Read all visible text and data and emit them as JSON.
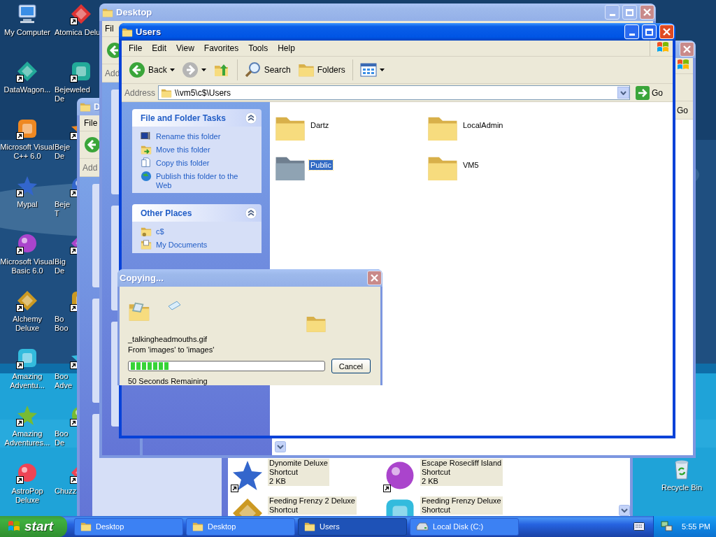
{
  "desktop_icons": [
    {
      "lines": [
        "My Computer"
      ],
      "shortcut": false
    },
    {
      "lines": [
        "DataWagon..."
      ],
      "shortcut": true
    },
    {
      "lines": [
        "Microsoft Visual",
        "C++ 6.0"
      ],
      "shortcut": true
    },
    {
      "lines": [
        "Mypal"
      ],
      "shortcut": true
    },
    {
      "lines": [
        "Microsoft Visual",
        "Basic 6.0"
      ],
      "shortcut": true
    },
    {
      "lines": [
        "Alchemy",
        "Deluxe"
      ],
      "shortcut": true
    },
    {
      "lines": [
        "Amazing",
        "Adventu..."
      ],
      "shortcut": true
    },
    {
      "lines": [
        "Amazing",
        "Adventures..."
      ],
      "shortcut": true
    },
    {
      "lines": [
        "AstroPop",
        "Deluxe"
      ],
      "shortcut": true
    },
    {
      "lines": [
        "Atomica Delu"
      ],
      "shortcut": true
    },
    {
      "lines": [
        "Bejeweled",
        "De"
      ],
      "shortcut": true
    },
    {
      "lines": [
        "Beje",
        "De"
      ],
      "shortcut": true
    },
    {
      "lines": [
        "Beje",
        "T"
      ],
      "shortcut": true
    },
    {
      "lines": [
        "Big",
        "De"
      ],
      "shortcut": true
    },
    {
      "lines": [
        "Bo",
        "Boo"
      ],
      "shortcut": true
    },
    {
      "lines": [
        "Boo",
        "Adve"
      ],
      "shortcut": true
    },
    {
      "lines": [
        "Boo",
        "De"
      ],
      "shortcut": true
    },
    {
      "lines": [
        "Chuzz"
      ],
      "shortcut": true
    }
  ],
  "recycle_bin": {
    "label": "Recycle Bin"
  },
  "background_windows": [
    {
      "title": "D",
      "active": false,
      "menu": [
        "File"
      ],
      "address_label": "Add",
      "files": [
        {
          "lines": [
            "Dynomite Deluxe",
            "Shortcut",
            "2 KB"
          ],
          "selected": true,
          "shortcut": true
        },
        {
          "lines": [
            "Escape Rosecliff Island",
            "Shortcut",
            "2 KB"
          ],
          "selected": true,
          "shortcut": true
        },
        {
          "lines": [
            "Feeding Frenzy 2 Deluxe",
            "Shortcut"
          ],
          "selected": true
        },
        {
          "lines": [
            "Feeding Frenzy Deluxe",
            "Shortcut"
          ],
          "selected": true
        }
      ]
    },
    {
      "title": "Desktop",
      "active": false,
      "title_buttons": [
        {
          "kind": "minimize"
        },
        {
          "kind": "maximize"
        },
        {
          "kind": "close"
        }
      ],
      "menu": [
        "Fil"
      ],
      "address_label": "Add"
    },
    {
      "active": false,
      "title_buttons": [
        {
          "kind": "close"
        }
      ],
      "go": "Go"
    }
  ],
  "window": {
    "title": "Users",
    "active": true,
    "title_buttons": [
      {
        "kind": "minimize"
      },
      {
        "kind": "maximize"
      },
      {
        "kind": "close"
      }
    ],
    "menu": [
      "File",
      "Edit",
      "View",
      "Favorites",
      "Tools",
      "Help"
    ],
    "toolbar": [
      {
        "kind": "back",
        "label": "Back",
        "disabled": false
      },
      {
        "kind": "forward",
        "disabled": true
      },
      {
        "kind": "up"
      },
      {
        "kind": "search",
        "label": "Search"
      },
      {
        "kind": "folders",
        "label": "Folders"
      },
      {
        "kind": "views"
      }
    ],
    "address": {
      "label": "Address",
      "value": "\\\\vm5\\c$\\Users",
      "go": "Go"
    },
    "task_panels": [
      {
        "title": "File and Folder Tasks",
        "expanded": true,
        "items": [
          {
            "kind": "rename",
            "label": "Rename this folder"
          },
          {
            "kind": "move",
            "label": "Move this folder"
          },
          {
            "kind": "copy",
            "label": "Copy this folder"
          },
          {
            "kind": "publish",
            "label": "Publish this folder to the Web"
          }
        ]
      },
      {
        "title": "Other Places",
        "expanded": true,
        "items": [
          {
            "kind": "share",
            "label": "c$"
          },
          {
            "kind": "documents",
            "label": "My Documents"
          }
        ]
      }
    ],
    "folders": [
      {
        "name": "Dartz",
        "selected": false
      },
      {
        "name": "LocalAdmin",
        "selected": false
      },
      {
        "name": "Public",
        "selected": true
      },
      {
        "name": "VM5",
        "selected": false
      }
    ]
  },
  "copy_dialog": {
    "title": "Copying...",
    "active": false,
    "title_buttons": [
      {
        "kind": "close"
      }
    ],
    "file": "_talkingheadmouths.gif",
    "from": "From 'images' to 'images'",
    "progress": {
      "level": 0.2
    },
    "remaining": "50 Seconds Remaining",
    "cancel": "Cancel"
  },
  "taskbar": {
    "start": "start",
    "tasks": [
      {
        "kind": "folder",
        "label": "Desktop",
        "selected": false
      },
      {
        "kind": "folder",
        "label": "Desktop",
        "selected": false
      },
      {
        "kind": "folder",
        "label": "Users",
        "selected": true
      },
      {
        "kind": "drive",
        "label": "Local Disk (C:)",
        "selected": false
      }
    ],
    "clock": "5:55 PM"
  }
}
